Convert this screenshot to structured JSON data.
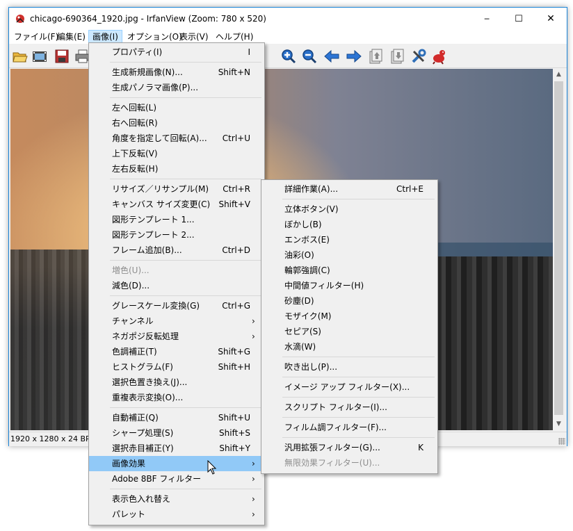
{
  "window": {
    "title": "chicago-690364_1920.jpg - IrfanView (Zoom: 780 x 520)",
    "minimize": "─",
    "maximize": "☐",
    "close": "✕"
  },
  "menubar": [
    "ファイル(F)",
    "編集(E)",
    "画像(I)",
    "オプション(O)",
    "表示(V)",
    "ヘルプ(H)"
  ],
  "toolbar": {
    "icons": [
      "open-icon",
      "slideshow-icon",
      "save-icon",
      "print-icon",
      "zoom-in-icon",
      "zoom-out-icon",
      "previous-icon",
      "next-icon",
      "first-file-icon",
      "last-file-icon",
      "options-icon",
      "about-icon"
    ]
  },
  "status": {
    "info": "1920 x 1280 x 24 BPP"
  },
  "image_menu": [
    {
      "label": "プロパティ(I)",
      "shortcut": "I"
    },
    {
      "sep": true
    },
    {
      "label": "生成新規画像(N)...",
      "shortcut": "Shift+N"
    },
    {
      "label": "生成パノラマ画像(P)..."
    },
    {
      "sep": true
    },
    {
      "label": "左へ回転(L)"
    },
    {
      "label": "右へ回転(R)"
    },
    {
      "label": "角度を指定して回転(A)...",
      "shortcut": "Ctrl+U"
    },
    {
      "label": "上下反転(V)"
    },
    {
      "label": "左右反転(H)"
    },
    {
      "sep": true
    },
    {
      "label": "リサイズ／リサンプル(M)",
      "shortcut": "Ctrl+R"
    },
    {
      "label": "キャンバス サイズ変更(C)",
      "shortcut": "Shift+V"
    },
    {
      "label": "図形テンプレート 1..."
    },
    {
      "label": "図形テンプレート 2..."
    },
    {
      "label": "フレーム追加(B)...",
      "shortcut": "Ctrl+D"
    },
    {
      "sep": true
    },
    {
      "label": "増色(U)...",
      "disabled": true
    },
    {
      "label": "減色(D)..."
    },
    {
      "sep": true
    },
    {
      "label": "グレースケール変換(G)",
      "shortcut": "Ctrl+G"
    },
    {
      "label": "チャンネル",
      "submenu": true
    },
    {
      "label": "ネガポジ反転処理",
      "submenu": true
    },
    {
      "label": "色調補正(T)",
      "shortcut": "Shift+G"
    },
    {
      "label": "ヒストグラム(F)",
      "shortcut": "Shift+H"
    },
    {
      "label": "選択色置き換え(J)..."
    },
    {
      "label": "重複表示変換(O)..."
    },
    {
      "sep": true
    },
    {
      "label": "自動補正(Q)",
      "shortcut": "Shift+U"
    },
    {
      "label": "シャープ処理(S)",
      "shortcut": "Shift+S"
    },
    {
      "label": "選択赤目補正(Y)",
      "shortcut": "Shift+Y"
    },
    {
      "label": "画像効果",
      "submenu": true,
      "highlighted": true
    },
    {
      "label": "Adobe 8BF フィルター",
      "submenu": true
    },
    {
      "sep": true
    },
    {
      "label": "表示色入れ替え",
      "submenu": true
    },
    {
      "label": "パレット",
      "submenu": true
    }
  ],
  "effects_menu": [
    {
      "label": "詳細作業(A)...",
      "shortcut": "Ctrl+E"
    },
    {
      "sep": true
    },
    {
      "label": "立体ボタン(V)"
    },
    {
      "label": "ぼかし(B)"
    },
    {
      "label": "エンボス(E)"
    },
    {
      "label": "油彩(O)"
    },
    {
      "label": "輪郭強調(C)"
    },
    {
      "label": "中間値フィルター(H)"
    },
    {
      "label": "砂塵(D)"
    },
    {
      "label": "モザイク(M)"
    },
    {
      "label": "セピア(S)"
    },
    {
      "label": "水滴(W)"
    },
    {
      "sep": true
    },
    {
      "label": "吹き出し(P)..."
    },
    {
      "sep": true
    },
    {
      "label": "イメージ アップ フィルター(X)..."
    },
    {
      "sep": true
    },
    {
      "label": "スクリプト フィルター(I)..."
    },
    {
      "sep": true
    },
    {
      "label": "フィルム調フィルター(F)..."
    },
    {
      "sep": true
    },
    {
      "label": "汎用拡張フィルター(G)...",
      "shortcut": "K"
    },
    {
      "label": "無限効果フィルター(U)...",
      "disabled": true
    }
  ]
}
